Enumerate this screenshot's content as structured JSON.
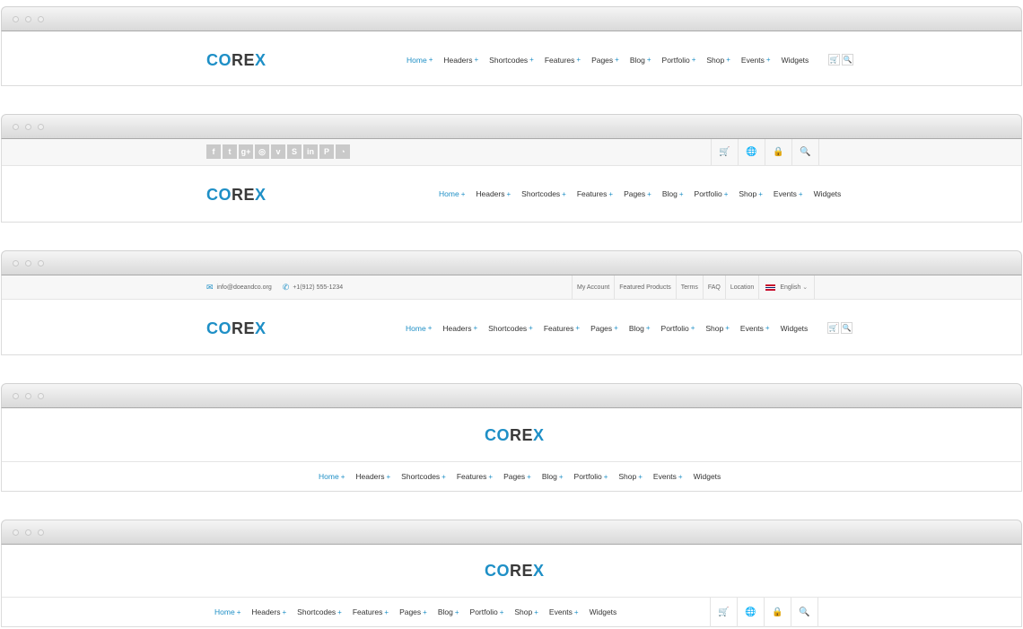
{
  "logo": {
    "co": "CO",
    "re": "RE",
    "x": "X"
  },
  "nav": {
    "home": "Home",
    "headers": "Headers",
    "shortcodes": "Shortcodes",
    "features": "Features",
    "pages": "Pages",
    "blog": "Blog",
    "portfolio": "Portfolio",
    "shop": "Shop",
    "events": "Events",
    "widgets": "Widgets",
    "plus": "+"
  },
  "icons": {
    "cart": "cart-icon",
    "search": "search-icon",
    "globe": "globe-icon",
    "lock": "lock-icon",
    "email": "envelope-icon",
    "phone": "phone-icon"
  },
  "glyphs": {
    "cart": "🛒",
    "search": "🔍",
    "globe": "🌐",
    "lock": "🔒",
    "email": "✉",
    "phone": "✆",
    "chevron": "⌄"
  },
  "social": [
    {
      "name": "facebook-icon",
      "glyph": "f"
    },
    {
      "name": "twitter-icon",
      "glyph": "t"
    },
    {
      "name": "google-plus-icon",
      "glyph": "g+"
    },
    {
      "name": "dribbble-icon",
      "glyph": "◎"
    },
    {
      "name": "vimeo-icon",
      "glyph": "v"
    },
    {
      "name": "skype-icon",
      "glyph": "S"
    },
    {
      "name": "linkedin-icon",
      "glyph": "in"
    },
    {
      "name": "pinterest-icon",
      "glyph": "P"
    },
    {
      "name": "rss-icon",
      "glyph": "◔"
    }
  ],
  "contact": {
    "email": "info@doeandco.org",
    "phone": "+1(912) 555-1234"
  },
  "toplinks": {
    "account": "My Account",
    "featured": "Featured Products",
    "terms": "Terms",
    "faq": "FAQ",
    "location": "Location",
    "language": "English"
  },
  "colors": {
    "accent": "#1e8fc6",
    "text": "#333333"
  }
}
